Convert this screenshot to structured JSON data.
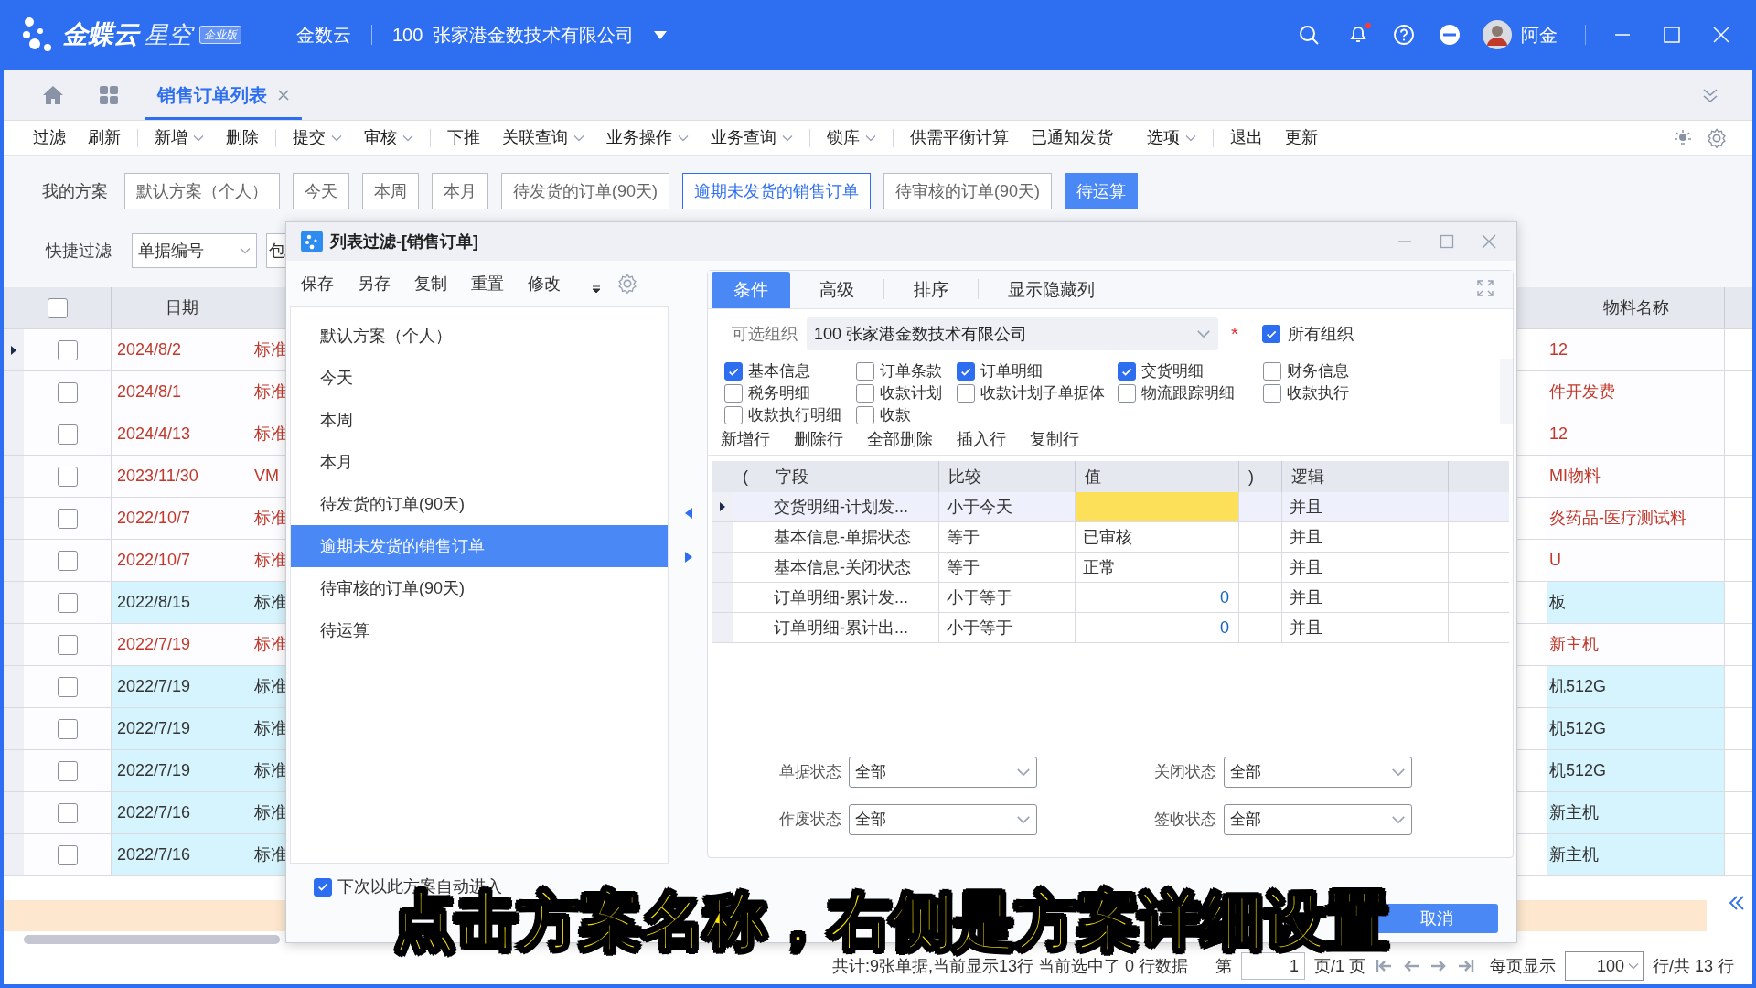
{
  "app_bar": {
    "logo_text": "金蝶云",
    "logo_subtext": "星空",
    "edition_badge": "企业版",
    "cloud": "金数云",
    "org": "100  张家港金数技术有限公司",
    "user": "阿金",
    "notification_dot": true
  },
  "tabs": [
    {
      "label": "销售订单列表",
      "selected": true
    }
  ],
  "toolbar": [
    [
      {
        "label": "过滤",
        "dropdown": false
      },
      {
        "label": "刷新",
        "dropdown": false
      }
    ],
    [
      {
        "label": "新增",
        "dropdown": true
      },
      {
        "label": "删除",
        "dropdown": false
      }
    ],
    [
      {
        "label": "提交",
        "dropdown": true
      },
      {
        "label": "审核",
        "dropdown": true
      }
    ],
    [
      {
        "label": "下推",
        "dropdown": false
      },
      {
        "label": "关联查询",
        "dropdown": true
      },
      {
        "label": "业务操作",
        "dropdown": true
      },
      {
        "label": "业务查询",
        "dropdown": true
      }
    ],
    [
      {
        "label": "锁库",
        "dropdown": true
      }
    ],
    [
      {
        "label": "供需平衡计算",
        "dropdown": false
      },
      {
        "label": "已通知发货",
        "dropdown": false
      }
    ],
    [
      {
        "label": "选项",
        "dropdown": true
      }
    ],
    [
      {
        "label": "退出",
        "dropdown": false
      },
      {
        "label": "更新",
        "dropdown": false
      }
    ]
  ],
  "schemes": {
    "label": "我的方案",
    "items": [
      {
        "label": "默认方案（个人）",
        "selected": false,
        "focused": false
      },
      {
        "label": "今天",
        "selected": false,
        "focused": false
      },
      {
        "label": "本周",
        "selected": false,
        "focused": false
      },
      {
        "label": "本月",
        "selected": false,
        "focused": false
      },
      {
        "label": "待发货的订单(90天)",
        "selected": false,
        "focused": false
      },
      {
        "label": "逾期未发货的销售订单",
        "selected": false,
        "focused": true
      },
      {
        "label": "待审核的订单(90天)",
        "selected": false,
        "focused": false
      },
      {
        "label": "待运算",
        "selected": true,
        "focused": false
      }
    ]
  },
  "quick_filter": {
    "label": "快捷过滤",
    "field": "单据编号",
    "next_field": "包"
  },
  "table": {
    "all_checked": false,
    "columns": [
      "日期",
      "物料名称"
    ],
    "rows": [
      {
        "current": true,
        "checked": false,
        "overdue": true,
        "date": "2024/8/2",
        "column_3": "标准",
        "material": "12"
      },
      {
        "current": false,
        "checked": false,
        "overdue": true,
        "date": "2024/8/1",
        "column_3": "标准",
        "material": "件开发费"
      },
      {
        "current": false,
        "checked": false,
        "overdue": true,
        "date": "2024/4/13",
        "column_3": "标准",
        "material": "12"
      },
      {
        "current": false,
        "checked": false,
        "overdue": true,
        "date": "2023/11/30",
        "column_3": "VM",
        "material": "MI物料"
      },
      {
        "current": false,
        "checked": false,
        "overdue": true,
        "date": "2022/10/7",
        "column_3": "标准",
        "material": "炎药品-医疗测试料"
      },
      {
        "current": false,
        "checked": false,
        "overdue": true,
        "date": "2022/10/7",
        "column_3": "标准",
        "material": "U"
      },
      {
        "current": false,
        "checked": false,
        "overdue": false,
        "date": "2022/8/15",
        "column_3": "标准",
        "material": "板"
      },
      {
        "current": false,
        "checked": false,
        "overdue": true,
        "date": "2022/7/19",
        "column_3": "标准",
        "material": "新主机"
      },
      {
        "current": false,
        "checked": false,
        "overdue": false,
        "date": "2022/7/19",
        "column_3": "标准",
        "material": "机512G"
      },
      {
        "current": false,
        "checked": false,
        "overdue": false,
        "date": "2022/7/19",
        "column_3": "标准",
        "material": "机512G"
      },
      {
        "current": false,
        "checked": false,
        "overdue": false,
        "date": "2022/7/19",
        "column_3": "标准",
        "material": "机512G"
      },
      {
        "current": false,
        "checked": false,
        "overdue": false,
        "date": "2022/7/16",
        "column_3": "标准",
        "material": "新主机"
      },
      {
        "current": false,
        "checked": false,
        "overdue": false,
        "date": "2022/7/16",
        "column_3": "标准",
        "material": "新主机"
      }
    ]
  },
  "dialog": {
    "title": "列表过滤-[销售订单]",
    "scheme_actions": [
      "保存",
      "另存",
      "复制",
      "重置",
      "修改"
    ],
    "schemes": [
      {
        "label": "默认方案（个人）",
        "selected": false
      },
      {
        "label": "今天",
        "selected": false
      },
      {
        "label": "本周",
        "selected": false
      },
      {
        "label": "本月",
        "selected": false
      },
      {
        "label": "待发货的订单(90天)",
        "selected": false
      },
      {
        "label": "逾期未发货的销售订单",
        "selected": true
      },
      {
        "label": "待审核的订单(90天)",
        "selected": false
      },
      {
        "label": "待运算",
        "selected": false
      }
    ],
    "auto_enter": {
      "label": "下次以此方案自动进入",
      "checked": true
    },
    "tabs": [
      {
        "label": "条件",
        "selected": true
      },
      {
        "label": "高级",
        "selected": false
      },
      {
        "label": "排序",
        "selected": false
      },
      {
        "label": "显示隐藏列",
        "selected": false
      }
    ],
    "org": {
      "label": "可选组织",
      "value": "100 张家港金数技术有限公司",
      "required_mark": "*",
      "all_label": "所有组织",
      "all_checked": true
    },
    "sections": [
      {
        "label": "基本信息",
        "checked": true
      },
      {
        "label": "订单条款",
        "checked": false
      },
      {
        "label": "订单明细",
        "checked": true
      },
      {
        "label": "交货明细",
        "checked": true
      },
      {
        "label": "财务信息",
        "checked": false
      },
      {
        "label": "税务明细",
        "checked": false
      },
      {
        "label": "收款计划",
        "checked": false
      },
      {
        "label": "收款计划子单据体",
        "checked": false
      },
      {
        "label": "物流跟踪明细",
        "checked": false
      },
      {
        "label": "收款执行",
        "checked": false
      },
      {
        "label": "收款执行明细",
        "checked": false
      },
      {
        "label": "收款",
        "checked": false
      }
    ],
    "row_actions": [
      "新增行",
      "删除行",
      "全部删除",
      "插入行",
      "复制行"
    ],
    "columns": [
      "(",
      "字段",
      "比较",
      "值",
      ")",
      "逻辑"
    ],
    "conditions": [
      {
        "selected": true,
        "field": "交货明细-计划发...",
        "compare": "小于今天",
        "kind": "empty",
        "logic": "并且"
      },
      {
        "selected": false,
        "field": "基本信息-单据状态",
        "compare": "等于",
        "value": "已审核",
        "kind": "text",
        "logic": "并且"
      },
      {
        "selected": false,
        "field": "基本信息-关闭状态",
        "compare": "等于",
        "value": "正常",
        "kind": "text",
        "logic": "并且"
      },
      {
        "selected": false,
        "field": "订单明细-累计发...",
        "compare": "小于等于",
        "value": "0",
        "kind": "number",
        "logic": "并且"
      },
      {
        "selected": false,
        "field": "订单明细-累计出...",
        "compare": "小于等于",
        "value": "0",
        "kind": "number",
        "logic": "并且"
      }
    ],
    "status_filters": [
      {
        "label": "单据状态",
        "value": "全部"
      },
      {
        "label": "关闭状态",
        "value": "全部"
      },
      {
        "label": "作废状态",
        "value": "全部"
      },
      {
        "label": "签收状态",
        "value": "全部"
      }
    ],
    "cancel": "取消"
  },
  "status_bar": {
    "summary": "共计:9张单据,当前显示13行 当前选中了 0 行数据",
    "page_label": "第",
    "page": "1",
    "page_total": "页/1 页",
    "per_page_label": "每页显示",
    "per_page": "100",
    "total": "行/共 13 行"
  },
  "caption": "点击方案名称，右侧是方案详细设置"
}
